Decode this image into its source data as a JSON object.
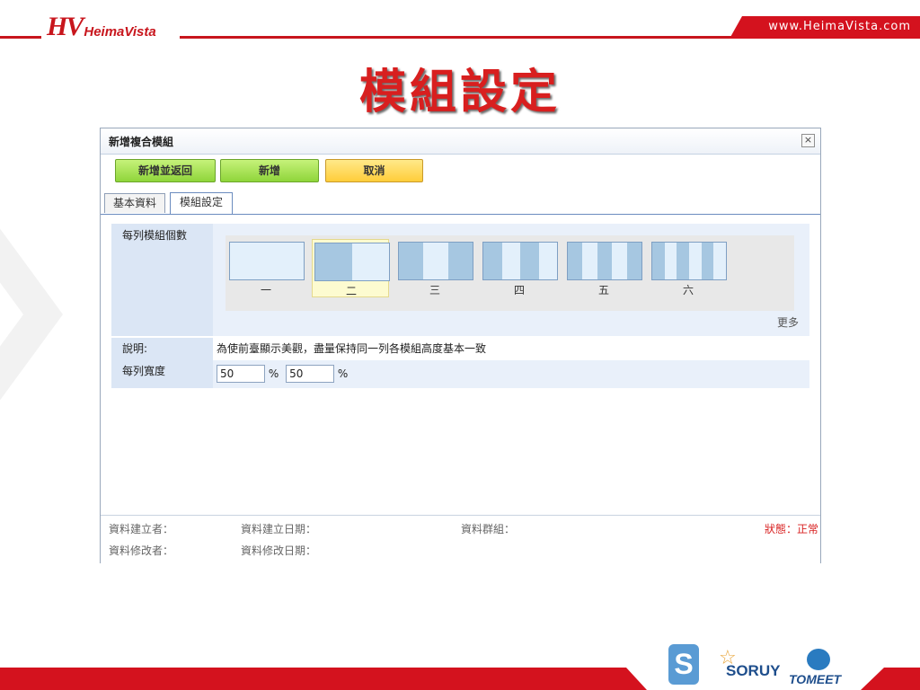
{
  "header": {
    "logo_mark": "HV",
    "logo_text": "HeimaVista",
    "website": "www.HeimaVista.com",
    "slide_title": "模組設定",
    "title_color": "#d81f1f",
    "brand_red": "#d4121e"
  },
  "dialog": {
    "title": "新增複合模組",
    "close_label": "×",
    "toolbar": {
      "add_and_return": "新增並返回",
      "add": "新增",
      "cancel": "取消"
    },
    "tabs": [
      {
        "label": "基本資料",
        "active": false
      },
      {
        "label": "模組設定",
        "active": true
      }
    ],
    "form": {
      "modules_per_row_label": "每列模組個數",
      "layout_options": [
        {
          "label": "一",
          "columns": 1,
          "selected": false
        },
        {
          "label": "二",
          "columns": 2,
          "selected": true
        },
        {
          "label": "三",
          "columns": 3,
          "selected": false
        },
        {
          "label": "四",
          "columns": 4,
          "selected": false
        },
        {
          "label": "五",
          "columns": 5,
          "selected": false
        },
        {
          "label": "六",
          "columns": 6,
          "selected": false
        }
      ],
      "more_label": "更多",
      "description_label": "說明:",
      "description_text": "為使前臺顯示美觀，盡量保持同一列各模組高度基本一致",
      "row_width_label": "每列寬度",
      "width_values": [
        "50",
        "50"
      ],
      "percent_sign": "%"
    },
    "footer": {
      "creator_label": "資料建立者：",
      "created_date_label": "資料建立日期：",
      "data_group_label": "資料群組：",
      "status_label": "狀態：正常",
      "modifier_label": "資料修改者：",
      "modified_date_label": "資料修改日期：",
      "status_color": "#d81f1f"
    }
  },
  "partners": {
    "s_logo": "S",
    "soruy": "SORUY",
    "tomeet": "TOMEET"
  }
}
